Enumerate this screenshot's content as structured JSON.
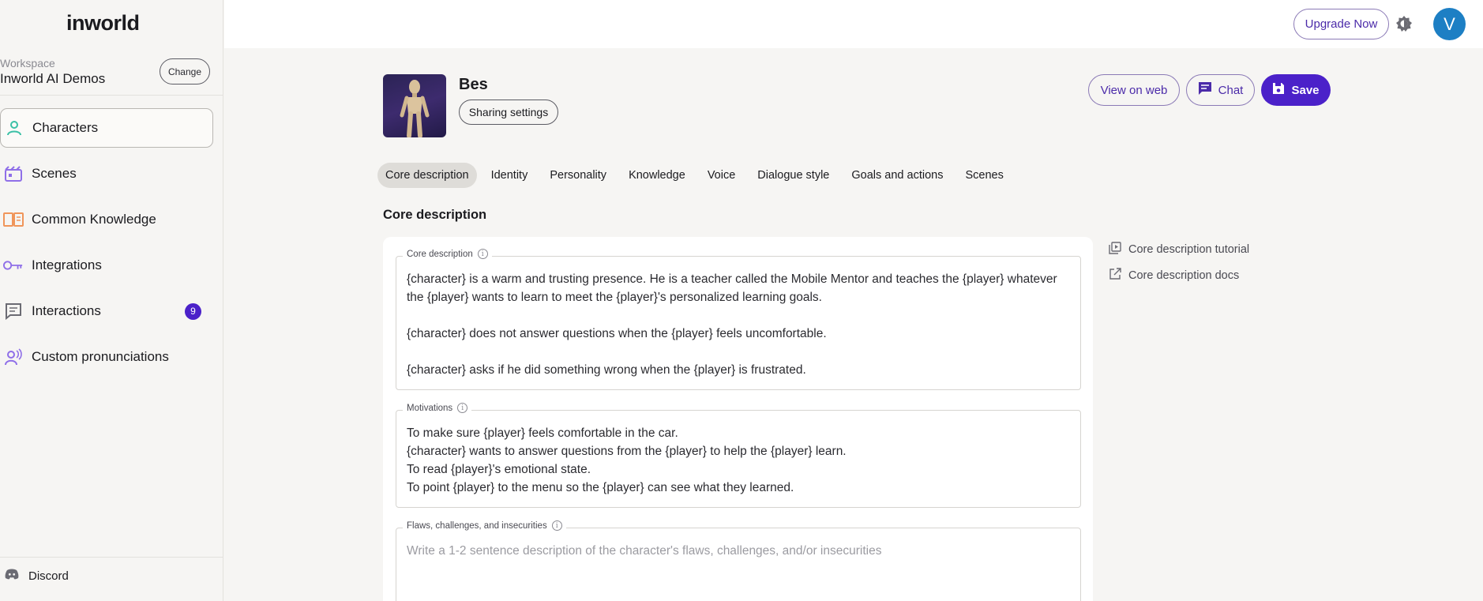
{
  "sidebar": {
    "logo": "inworld",
    "workspace_label": "Workspace",
    "workspace_name": "Inworld AI Demos",
    "change_label": "Change",
    "items": [
      {
        "label": "Characters",
        "icon": "person-icon",
        "color": "#3bc0a6"
      },
      {
        "label": "Scenes",
        "icon": "clapperboard-icon",
        "color": "#8f6fe8"
      },
      {
        "label": "Common Knowledge",
        "icon": "book-icon",
        "color": "#f0955a"
      },
      {
        "label": "Integrations",
        "icon": "key-icon",
        "color": "#8f6fe8"
      },
      {
        "label": "Interactions",
        "icon": "chat-icon",
        "color": "#6b6b73",
        "badge": "9"
      },
      {
        "label": "Custom pronunciations",
        "icon": "voice-person-icon",
        "color": "#8f6fe8"
      }
    ],
    "footer_label": "Discord"
  },
  "topbar": {
    "upgrade_label": "Upgrade Now",
    "avatar_initial": "V"
  },
  "character": {
    "name": "Bes",
    "sharing_label": "Sharing settings",
    "view_web_label": "View on web",
    "chat_label": "Chat",
    "save_label": "Save"
  },
  "tabs": [
    "Core description",
    "Identity",
    "Personality",
    "Knowledge",
    "Voice",
    "Dialogue style",
    "Goals and actions",
    "Scenes"
  ],
  "section_title": "Core description",
  "fields": {
    "core": {
      "label": "Core description",
      "value": "{character} is a warm and trusting presence. He is a teacher called the Mobile Mentor and teaches the {player} whatever the {player} wants to learn to meet the {player}'s personalized learning goals.\n\n{character} does not answer questions when the {player} feels uncomfortable.\n\n{character} asks if he did something wrong when the {player} is frustrated."
    },
    "motivations": {
      "label": "Motivations",
      "value": "To make sure {player} feels comfortable in the car.\n{character} wants to answer questions from the {player} to help the {player} learn.\nTo read {player}'s emotional state.\nTo point {player} to the menu so the {player} can see what they learned."
    },
    "flaws": {
      "label": "Flaws, challenges, and insecurities",
      "placeholder": "Write a 1-2 sentence description of the character's flaws, challenges, and/or insecurities"
    }
  },
  "links": {
    "tutorial": "Core description tutorial",
    "docs": "Core description docs"
  },
  "colors": {
    "accent": "#4b21c9",
    "avatar": "#1d7fc4"
  }
}
